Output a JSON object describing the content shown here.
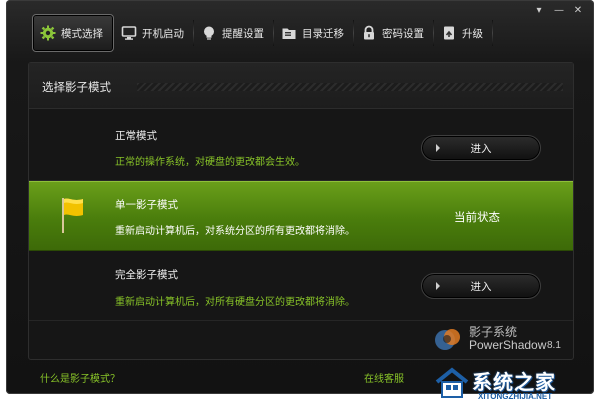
{
  "window": {
    "controls": {
      "menu_glyph": "▾",
      "minimize_glyph": "—",
      "close_glyph": "✕"
    }
  },
  "tabs": [
    {
      "label": "模式选择",
      "icon": "gear-icon",
      "active": true
    },
    {
      "label": "开机启动",
      "icon": "monitor-icon",
      "active": false
    },
    {
      "label": "提醒设置",
      "icon": "bulb-icon",
      "active": false
    },
    {
      "label": "目录迁移",
      "icon": "folder-icon",
      "active": false
    },
    {
      "label": "密码设置",
      "icon": "lock-icon",
      "active": false
    },
    {
      "label": "升级",
      "icon": "upgrade-icon",
      "active": false
    }
  ],
  "panel": {
    "title": "选择影子模式",
    "modes": {
      "normal": {
        "name": "正常模式",
        "desc": "正常的操作系统，对硬盘的更改都会生效。",
        "button": "进入"
      },
      "single": {
        "name": "单一影子模式",
        "desc": "重新启动计算机后，对系统分区的所有更改都将消除。",
        "status": "当前状态",
        "icon": "flag-icon"
      },
      "full": {
        "name": "完全影子模式",
        "desc": "重新启动计算机后，对所有硬盘分区的更改都将消除。",
        "button": "进入"
      }
    }
  },
  "logo": {
    "cn": "影子系统",
    "en": "PowerShadow",
    "version": "8.1"
  },
  "footer": {
    "help_link": "什么是影子模式？",
    "support_link": "在线客服"
  },
  "watermark": {
    "text": "系统之家",
    "url": "XITONGZHIJIA.NET"
  },
  "colors": {
    "accent_green": "#88c428",
    "active_row": "#5a8f14",
    "flag": "#f2c200"
  }
}
